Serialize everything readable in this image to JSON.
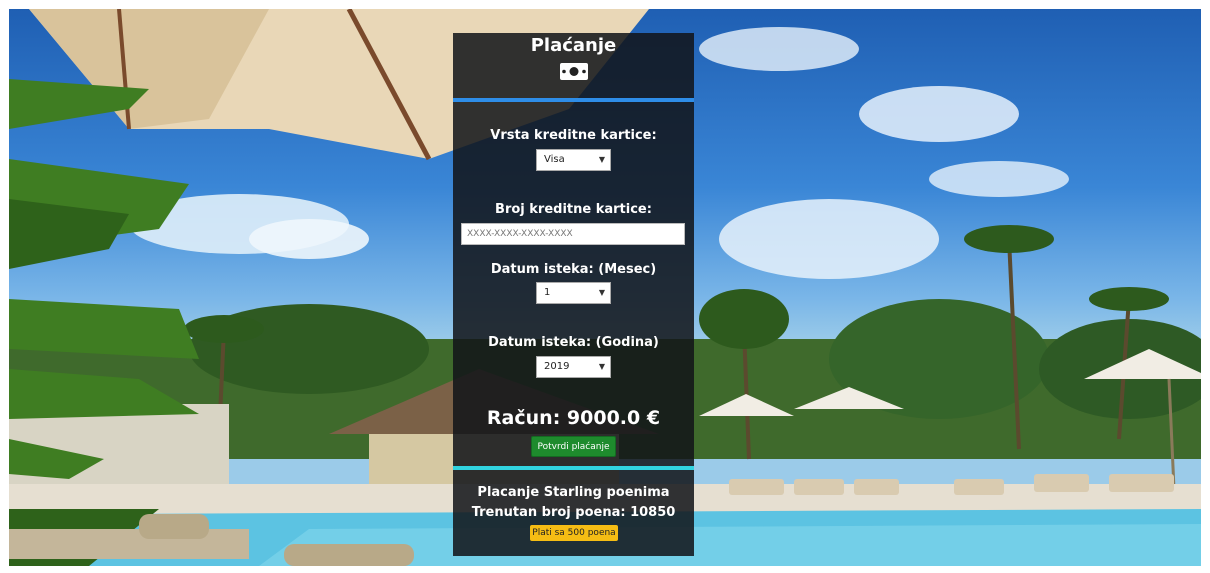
{
  "payment": {
    "title": "Plaćanje",
    "title_icon": "money-bill-icon",
    "card_type_label": "Vrsta kreditne kartice:",
    "card_type_value": "Visa",
    "card_number_label": "Broj kreditne kartice:",
    "card_number_placeholder": "XXXX-XXXX-XXXX-XXXX",
    "exp_month_label": "Datum isteka: (Mesec)",
    "exp_month_value": "1",
    "exp_year_label": "Datum isteka: (Godina)",
    "exp_year_value": "2019",
    "amount_text": "Račun: 9000.0 €",
    "confirm_button": "Potvrdi plaćanje"
  },
  "points": {
    "title": "Placanje Starling poenima",
    "current_points": "Trenutan broj poena: 10850",
    "pay_button": "Plati sa 500 poena"
  },
  "colors": {
    "panel_bg": "#121418",
    "divider_blue": "#2e8de8",
    "divider_cyan": "#31d3e0",
    "confirm_green": "#1e8b2d",
    "points_yellow": "#f5bd14"
  }
}
